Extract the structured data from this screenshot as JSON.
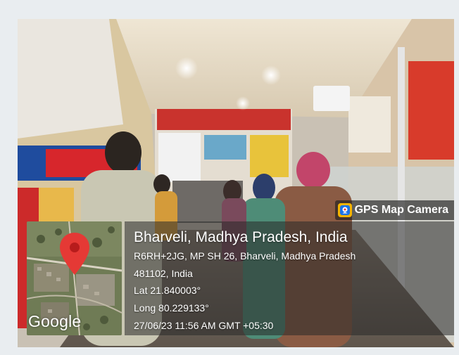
{
  "overlay": {
    "app_badge": "GPS Map Camera",
    "title": "Bharveli, Madhya Pradesh, India",
    "address_line1": "R6RH+2JG, MP SH 26, Bharveli, Madhya Pradesh",
    "address_line2": "481102, India",
    "latitude": "Lat 21.840003°",
    "longitude": "Long 80.229133°",
    "timestamp": "27/06/23 11:56 AM GMT +05:30",
    "map_attribution": "Google"
  },
  "icons": {
    "badge_icon": "gps-map-camera-icon",
    "map_marker": "map-pin-icon"
  },
  "colors": {
    "pin": "#e53935",
    "overlay_panel": "#282828",
    "text": "#ffffff"
  }
}
